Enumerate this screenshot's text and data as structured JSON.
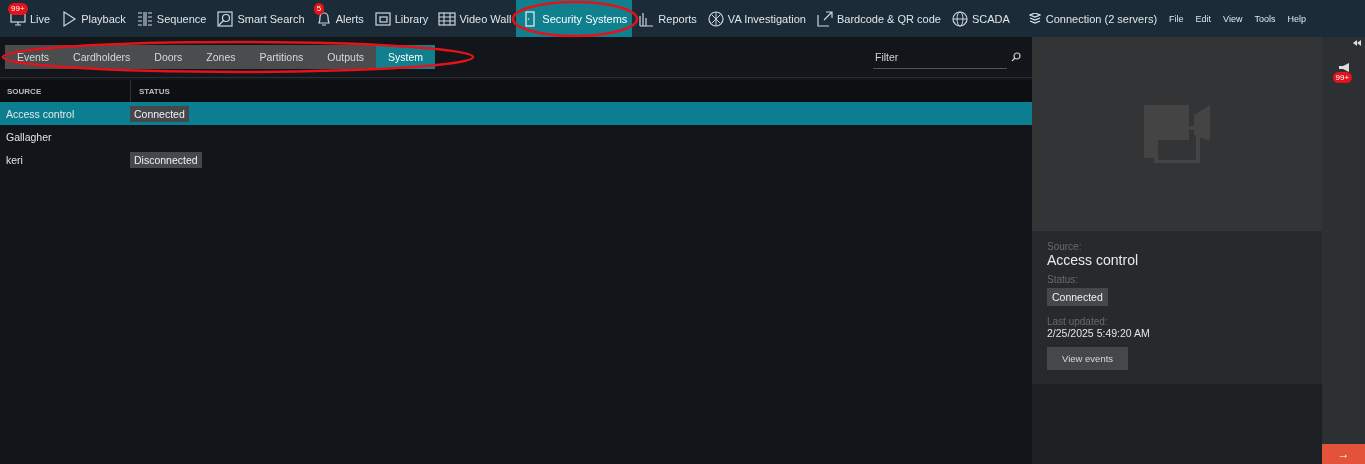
{
  "nav": [
    {
      "label": "Live",
      "selected": false,
      "badge": "99+"
    },
    {
      "label": "Playback",
      "selected": false
    },
    {
      "label": "Sequence",
      "selected": false
    },
    {
      "label": "Smart Search",
      "selected": false
    },
    {
      "label": "Alerts",
      "selected": false,
      "badge": "5"
    },
    {
      "label": "Library",
      "selected": false
    },
    {
      "label": "Video Wall",
      "selected": false
    },
    {
      "label": "Security Systems",
      "selected": true
    },
    {
      "label": "Reports",
      "selected": false
    },
    {
      "label": "VA Investigation",
      "selected": false
    },
    {
      "label": "Bardcode & QR code",
      "selected": false
    },
    {
      "label": "SCADA",
      "selected": false
    }
  ],
  "connection": "Connection (2 servers)",
  "menu": [
    "File",
    "Edit",
    "View",
    "Tools",
    "Help"
  ],
  "subtabs": [
    {
      "label": "Events",
      "selected": false
    },
    {
      "label": "Cardholders",
      "selected": false
    },
    {
      "label": "Doors",
      "selected": false
    },
    {
      "label": "Zones",
      "selected": false
    },
    {
      "label": "Partitions",
      "selected": false
    },
    {
      "label": "Outputs",
      "selected": false
    },
    {
      "label": "System",
      "selected": true
    }
  ],
  "filter": {
    "placeholder": "Filter"
  },
  "table": {
    "columns": [
      "SOURCE",
      "STATUS"
    ],
    "rows": [
      {
        "source": "Access control",
        "status": "Connected",
        "selected": true
      },
      {
        "source": "Gallagher",
        "selected": false
      },
      {
        "source": "keri",
        "status": "Disconnected",
        "selected": false
      }
    ]
  },
  "detail": {
    "source_label": "Source:",
    "source": "Access control",
    "status_label": "Status:",
    "status": "Connected",
    "updated_label": "Last updated:",
    "updated": "2/25/2025 5:49:20 AM",
    "button": "View events"
  },
  "side": {
    "badge": "99+",
    "action": "→"
  }
}
